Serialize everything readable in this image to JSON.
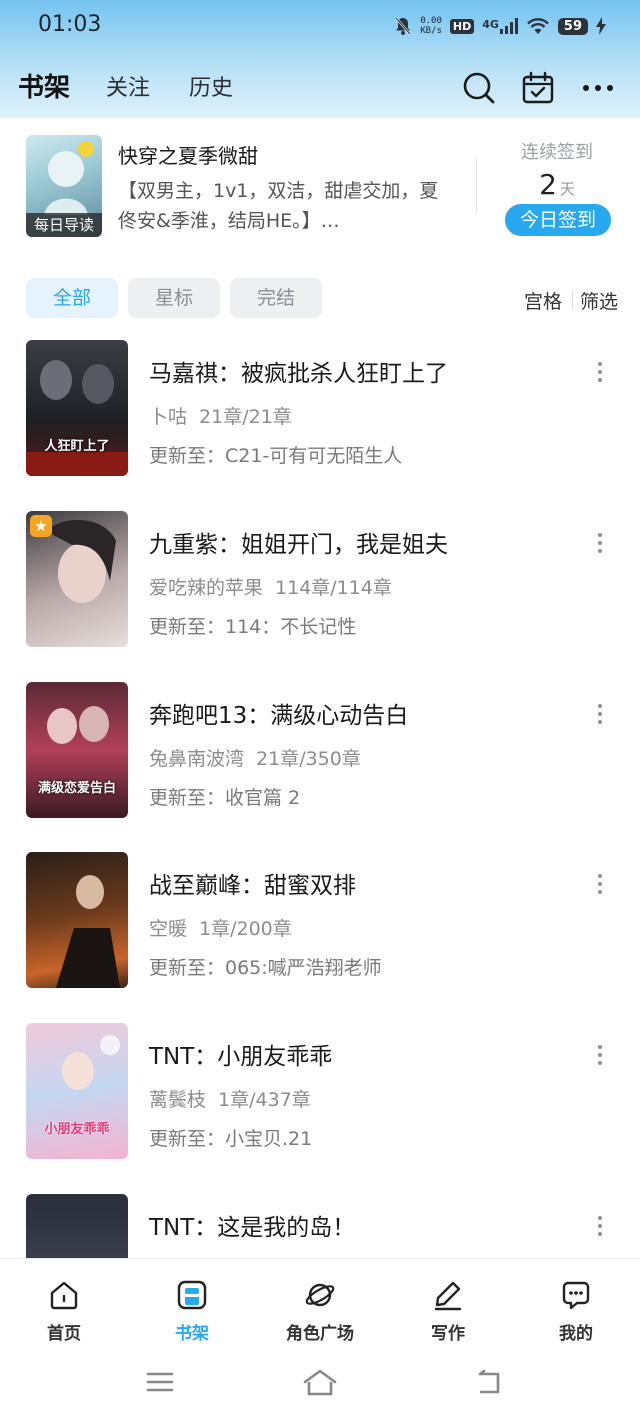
{
  "status_bar": {
    "time": "01:03",
    "net_speed_value": "0.00",
    "net_speed_unit": "KB/s",
    "hd": "HD",
    "signal": "4G",
    "battery": "59"
  },
  "header": {
    "tabs": [
      {
        "label": "书架",
        "active": true
      },
      {
        "label": "关注",
        "active": false
      },
      {
        "label": "历史",
        "active": false
      }
    ],
    "icons": [
      "search-icon",
      "calendar-check-icon",
      "more-horizontal-icon"
    ]
  },
  "featured": {
    "badge": "每日导读",
    "title": "快穿之夏季微甜",
    "desc": "【双男主，1v1，双洁，甜虐交加，夏佟安&季淮，结局HE。】…",
    "checkin_label": "连续签到",
    "checkin_days": "2",
    "checkin_unit": "天",
    "checkin_button": "今日签到"
  },
  "filters": [
    {
      "label": "全部",
      "active": true
    },
    {
      "label": "星标",
      "active": false
    },
    {
      "label": "完结",
      "active": false
    }
  ],
  "view": {
    "grid": "宫格",
    "filter": "筛选"
  },
  "books": [
    {
      "title": "马嘉祺：被疯批杀人狂盯上了",
      "author": "卜咕",
      "chapters": "21章/21章",
      "update": "更新至：C21-可有可无陌生人",
      "cover_text": "人狂盯上了",
      "starred": false
    },
    {
      "title": "九重紫：姐姐开门，我是姐夫",
      "author": "爱吃辣的苹果",
      "chapters": "114章/114章",
      "update": "更新至：114：不长记性",
      "cover_text": "",
      "starred": true
    },
    {
      "title": "奔跑吧13：满级心动告白",
      "author": "兔鼻南波湾",
      "chapters": "21章/350章",
      "update": "更新至：收官篇 2",
      "cover_text": "满级恋爱告白",
      "starred": false
    },
    {
      "title": "战至巅峰：甜蜜双排",
      "author": "空暖",
      "chapters": "1章/200章",
      "update": "更新至：065:喊严浩翔老师",
      "cover_text": "",
      "starred": false
    },
    {
      "title": "TNT：小朋友乖乖",
      "author": "蓠鬓枝",
      "chapters": "1章/437章",
      "update": "更新至：小宝贝.21",
      "cover_text": "小朋友乖乖",
      "starred": false
    },
    {
      "title": "TNT：这是我的岛！",
      "author": "",
      "chapters": "",
      "update": "",
      "cover_text": "",
      "starred": false
    }
  ],
  "bottom_nav": [
    {
      "label": "首页",
      "icon": "home-icon",
      "active": false
    },
    {
      "label": "书架",
      "icon": "bookshelf-icon",
      "active": true
    },
    {
      "label": "角色广场",
      "icon": "planet-icon",
      "active": false
    },
    {
      "label": "写作",
      "icon": "pen-icon",
      "active": false
    },
    {
      "label": "我的",
      "icon": "chat-bubble-icon",
      "active": false
    }
  ],
  "system_nav": [
    "menu-icon",
    "home-icon",
    "back-icon"
  ],
  "colors": {
    "accent": "#27a8ef",
    "star": "#f5a623"
  }
}
